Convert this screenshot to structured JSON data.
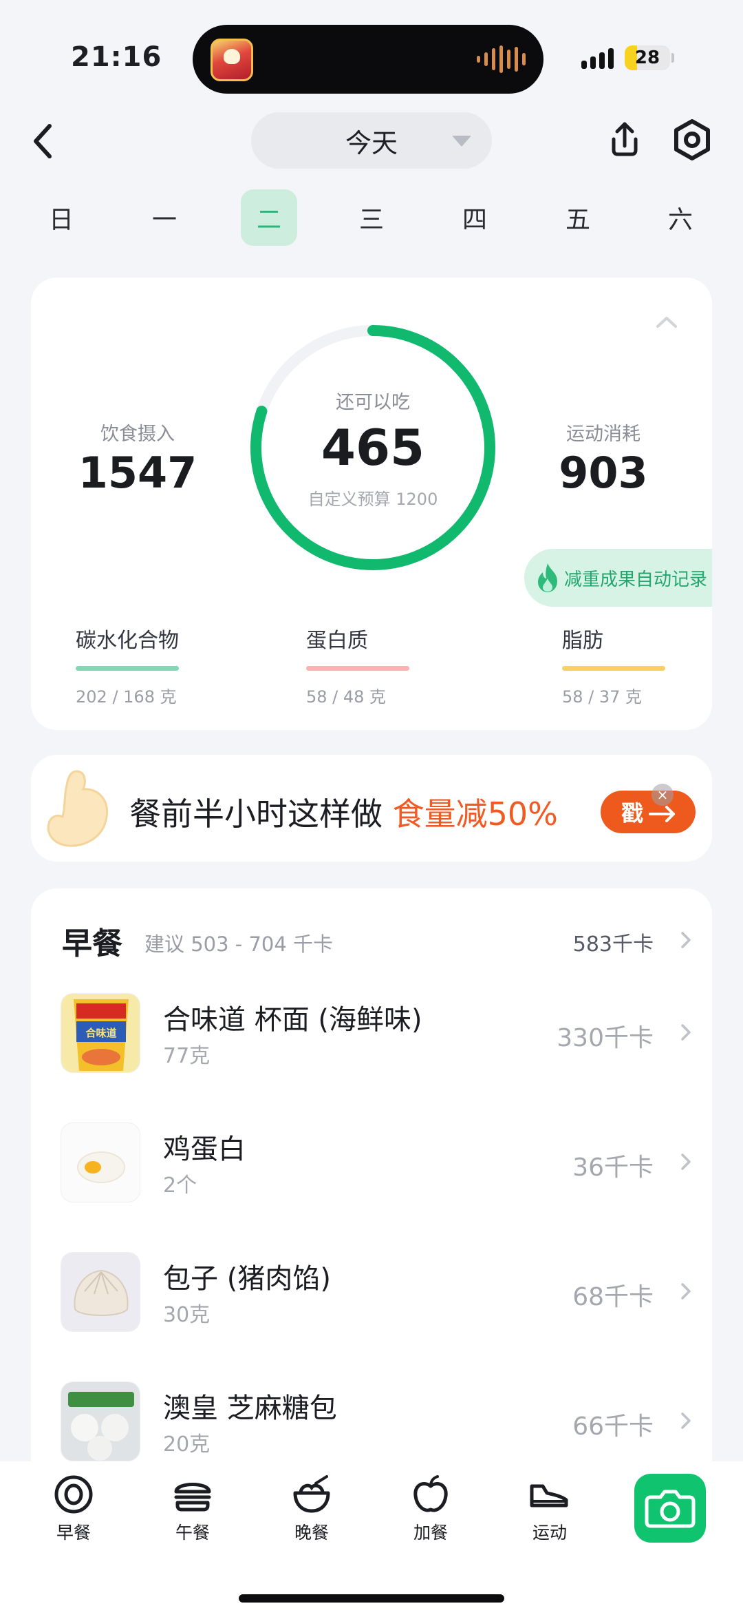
{
  "status_bar": {
    "time": "21:16",
    "battery": "28",
    "battery_level": 0.28
  },
  "header": {
    "date_label": "今天"
  },
  "week": {
    "days": [
      "日",
      "一",
      "二",
      "三",
      "四",
      "五",
      "六"
    ],
    "selected_index": 2
  },
  "summary": {
    "intake_label": "饮食摄入",
    "intake_value": "1547",
    "remaining_label": "还可以吃",
    "remaining_value": "465",
    "budget_label": "自定义预算 1200",
    "exercise_label": "运动消耗",
    "exercise_value": "903",
    "ring_progress": 0.8,
    "weight_badge": "减重成果自动记录",
    "macros": [
      {
        "name": "碳水化合物",
        "value": "202 / 168 克",
        "color": "#7fd9b4"
      },
      {
        "name": "蛋白质",
        "value": "58 / 48 克",
        "color": "#f9b3b2"
      },
      {
        "name": "脂肪",
        "value": "58 / 37 克",
        "color": "#f8d160"
      }
    ]
  },
  "promo": {
    "text_main": "餐前半小时这样做 ",
    "text_highlight": "食量减50%",
    "button": "戳",
    "close": "×"
  },
  "breakfast": {
    "title": "早餐",
    "hint": "建议 503 - 704 千卡",
    "total": "583千卡",
    "items": [
      {
        "name": "合味道 杯面 (海鲜味)",
        "amount": "77克",
        "kcal": "330千卡",
        "thumb_label": "合味道"
      },
      {
        "name": "鸡蛋白",
        "amount": "2个",
        "kcal": "36千卡"
      },
      {
        "name": "包子 (猪肉馅)",
        "amount": "30克",
        "kcal": "68千卡"
      },
      {
        "name": "澳皇 芝麻糖包",
        "amount": "20克",
        "kcal": "66千卡"
      }
    ]
  },
  "tabbar": {
    "tabs": [
      "早餐",
      "午餐",
      "晚餐",
      "加餐",
      "运动"
    ],
    "accent": "#10c46f"
  },
  "colors": {
    "accent_green": "#10b96e",
    "promo_orange": "#ee5a1d"
  }
}
